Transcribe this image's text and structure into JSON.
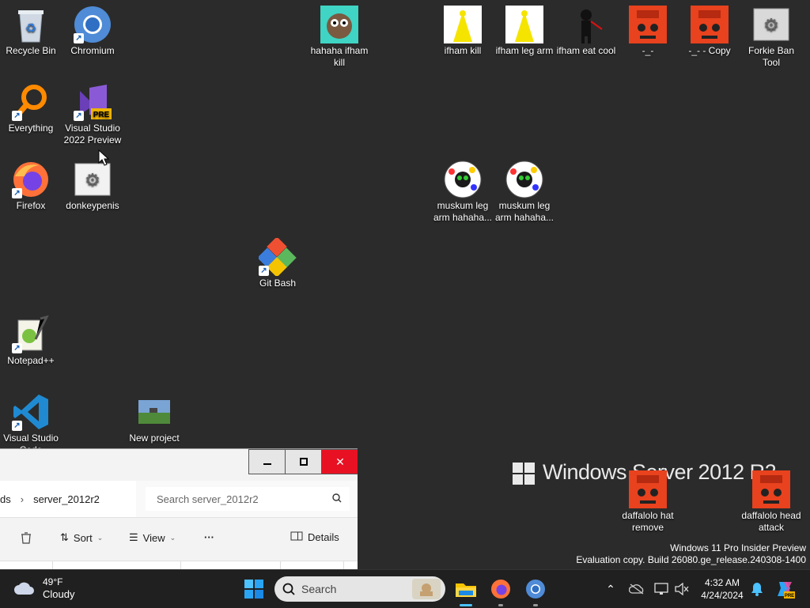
{
  "desktop": {
    "icons": [
      {
        "label": "Recycle Bin"
      },
      {
        "label": "Chromium"
      },
      {
        "label": "hahaha ifham kill"
      },
      {
        "label": "ifham kill"
      },
      {
        "label": "ifham leg arm"
      },
      {
        "label": "ifham eat cool"
      },
      {
        "label": "-_-"
      },
      {
        "label": "-_- - Copy"
      },
      {
        "label": "Forkie Ban Tool"
      },
      {
        "label": "Everything"
      },
      {
        "label": "Visual Studio 2022 Preview"
      },
      {
        "label": "Firefox"
      },
      {
        "label": "donkeypenis"
      },
      {
        "label": "muskum leg arm hahaha..."
      },
      {
        "label": "muskum leg arm hahaha..."
      },
      {
        "label": "Git Bash"
      },
      {
        "label": "Notepad++"
      },
      {
        "label": "Visual Studio Code"
      },
      {
        "label": "New project"
      },
      {
        "label": "daffalolo hat remove"
      },
      {
        "label": "daffalolo head attack"
      }
    ],
    "watermark": "Windows Server 2012 R2",
    "eval_line1": "Windows 11 Pro Insider Preview",
    "eval_line2": "Evaluation copy. Build 26080.ge_release.240308-1400"
  },
  "explorer": {
    "breadcrumb_prev": "ds",
    "breadcrumb_current": "server_2012r2",
    "search_placeholder": "Search server_2012r2",
    "sort_label": "Sort",
    "view_label": "View",
    "more_label": "···",
    "details_label": "Details"
  },
  "taskbar": {
    "weather_temp": "49°F",
    "weather_desc": "Cloudy",
    "search_label": "Search",
    "time": "4:32 AM",
    "date": "4/24/2024"
  },
  "colors": {
    "desktop": "#2b2b2b",
    "taskbar": "#202020",
    "accent": "#0078d4",
    "close": "#e81123"
  }
}
